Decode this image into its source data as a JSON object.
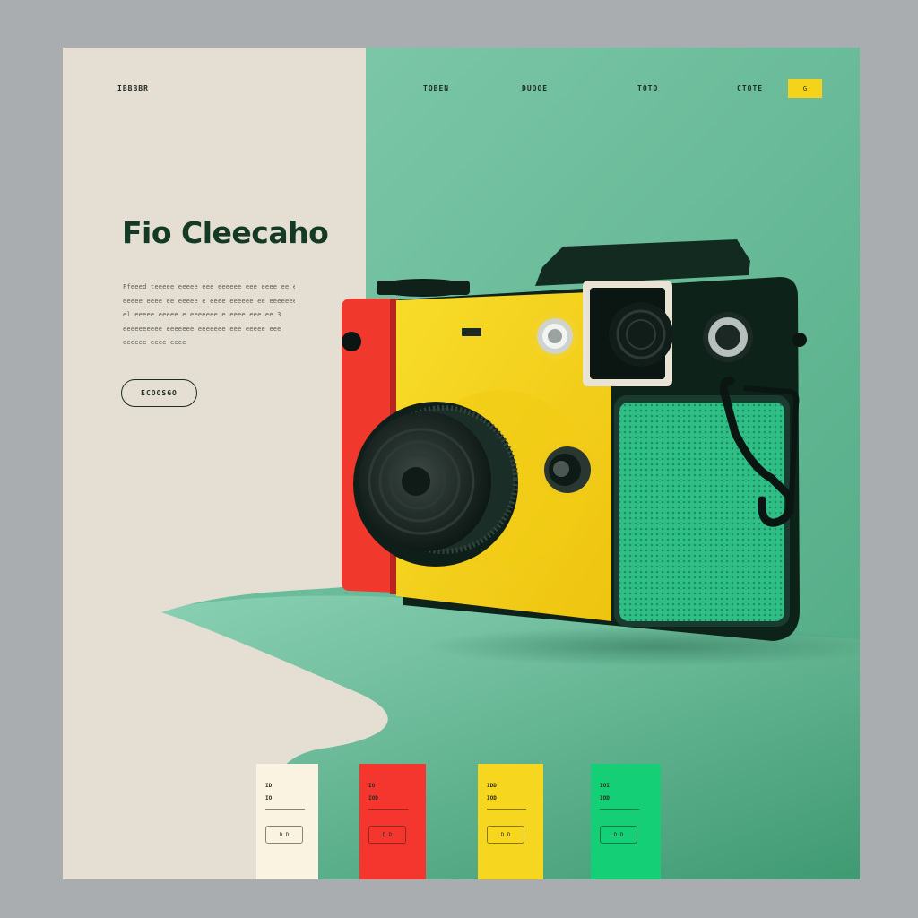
{
  "nav": {
    "brand": "IBBBBR",
    "links": [
      "TOBEN",
      "DUOOE",
      "TOTO",
      "CTOTE"
    ],
    "cta": "G"
  },
  "hero": {
    "title": "Fio Cleecaho",
    "description_lines": [
      "Ffeeed teeeee eeeee eee eeeeee eee eeee ee eeeee",
      "eeeee eeee ee eeeee e eeee eeeeee ee eeeeeeeee",
      "el eeeee eeeee e eeeeeee e eeee eee ee 3",
      "eeeeeeeeee eeeeeee eeeeeee eee eeeee eee",
      "eeeeee eeee eeee"
    ],
    "button": "ECOOSGO"
  },
  "swatches": [
    {
      "line1": "ID",
      "line2": "IO",
      "button": "D D",
      "color": "#fbf3e2"
    },
    {
      "line1": "IO",
      "line2": "IOD",
      "button": "D D",
      "color": "#f5362f"
    },
    {
      "line1": "IDD",
      "line2": "IOD",
      "button": "D D",
      "color": "#f7d61f"
    },
    {
      "line1": "IOI",
      "line2": "IOD",
      "button": "D D",
      "color": "#15cf76"
    }
  ],
  "colors": {
    "cream_panel": "#e4dfd2",
    "mint_background": "#7ac5a6",
    "camera_yellow": "#f7d21c",
    "camera_red": "#f0382c",
    "camera_green_grille": "#2fbf86",
    "camera_dark": "#0d2219",
    "accent_yellow": "#f5d31a",
    "title_green": "#143a26"
  },
  "icons": [
    "camera-illustration"
  ]
}
